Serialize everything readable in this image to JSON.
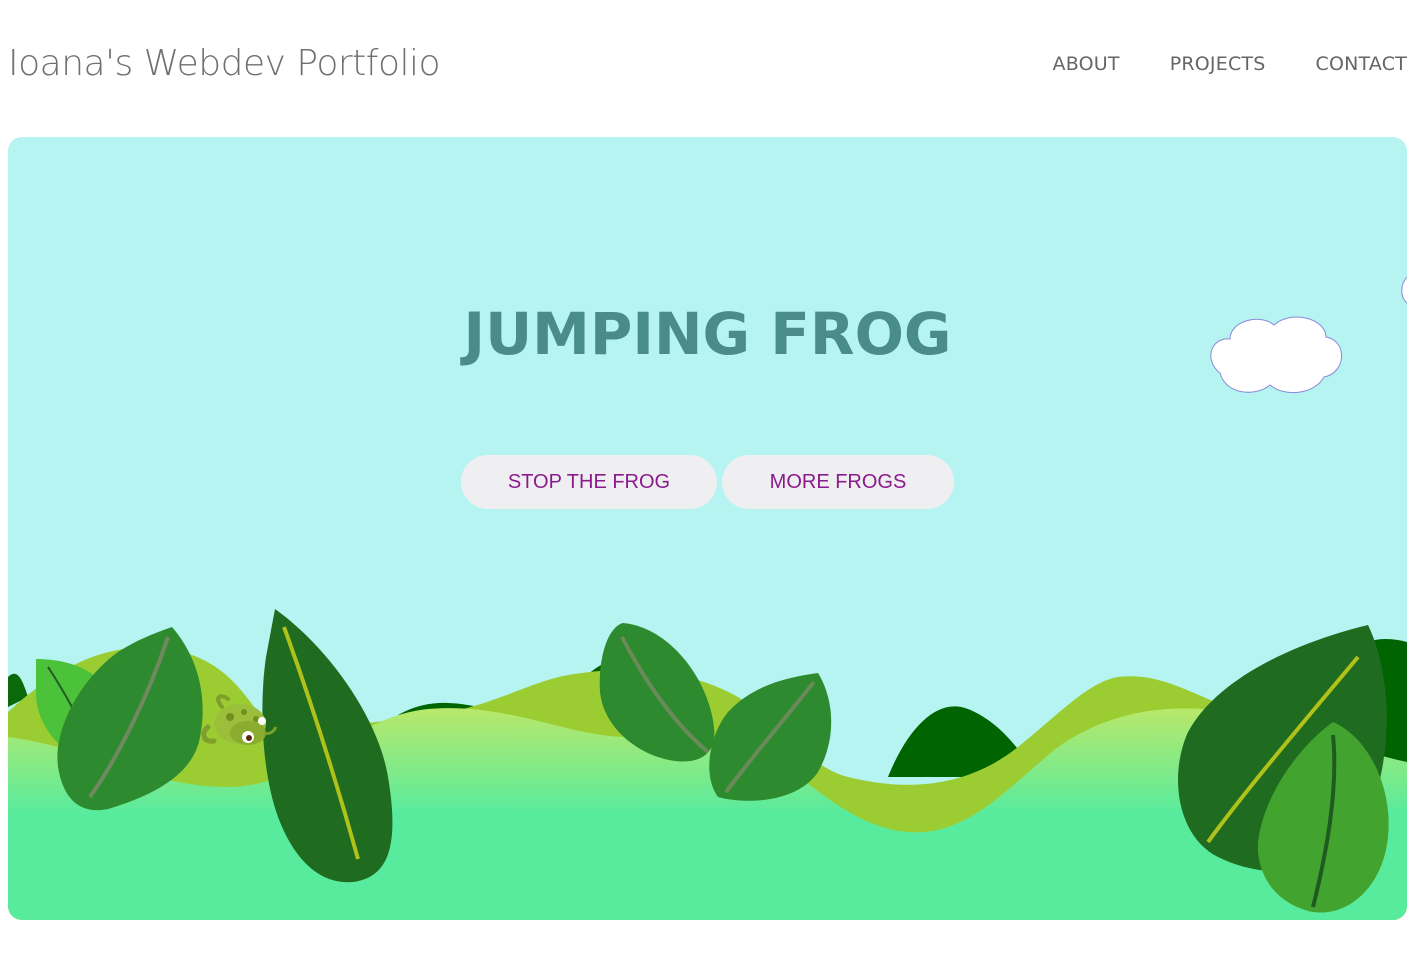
{
  "header": {
    "site_title": "Ioana's Webdev Portfolio",
    "nav": [
      {
        "label": "ABOUT"
      },
      {
        "label": "PROJECTS"
      },
      {
        "label": "CONTACT"
      }
    ]
  },
  "hero": {
    "title": "JUMPING FROG",
    "buttons": {
      "stop_label": "STOP THE FROG",
      "more_label": "MORE FROGS"
    },
    "colors": {
      "sky": "#b6f4f2",
      "title": "#4a8c8a",
      "button_text": "#8b1a8f",
      "button_bg": "#efeff1",
      "ground": "#58eb9e",
      "dark_leaf": "#1f6b1f",
      "mid_leaf": "#2e8a2e",
      "light_leaf": "#4cc23a"
    }
  }
}
